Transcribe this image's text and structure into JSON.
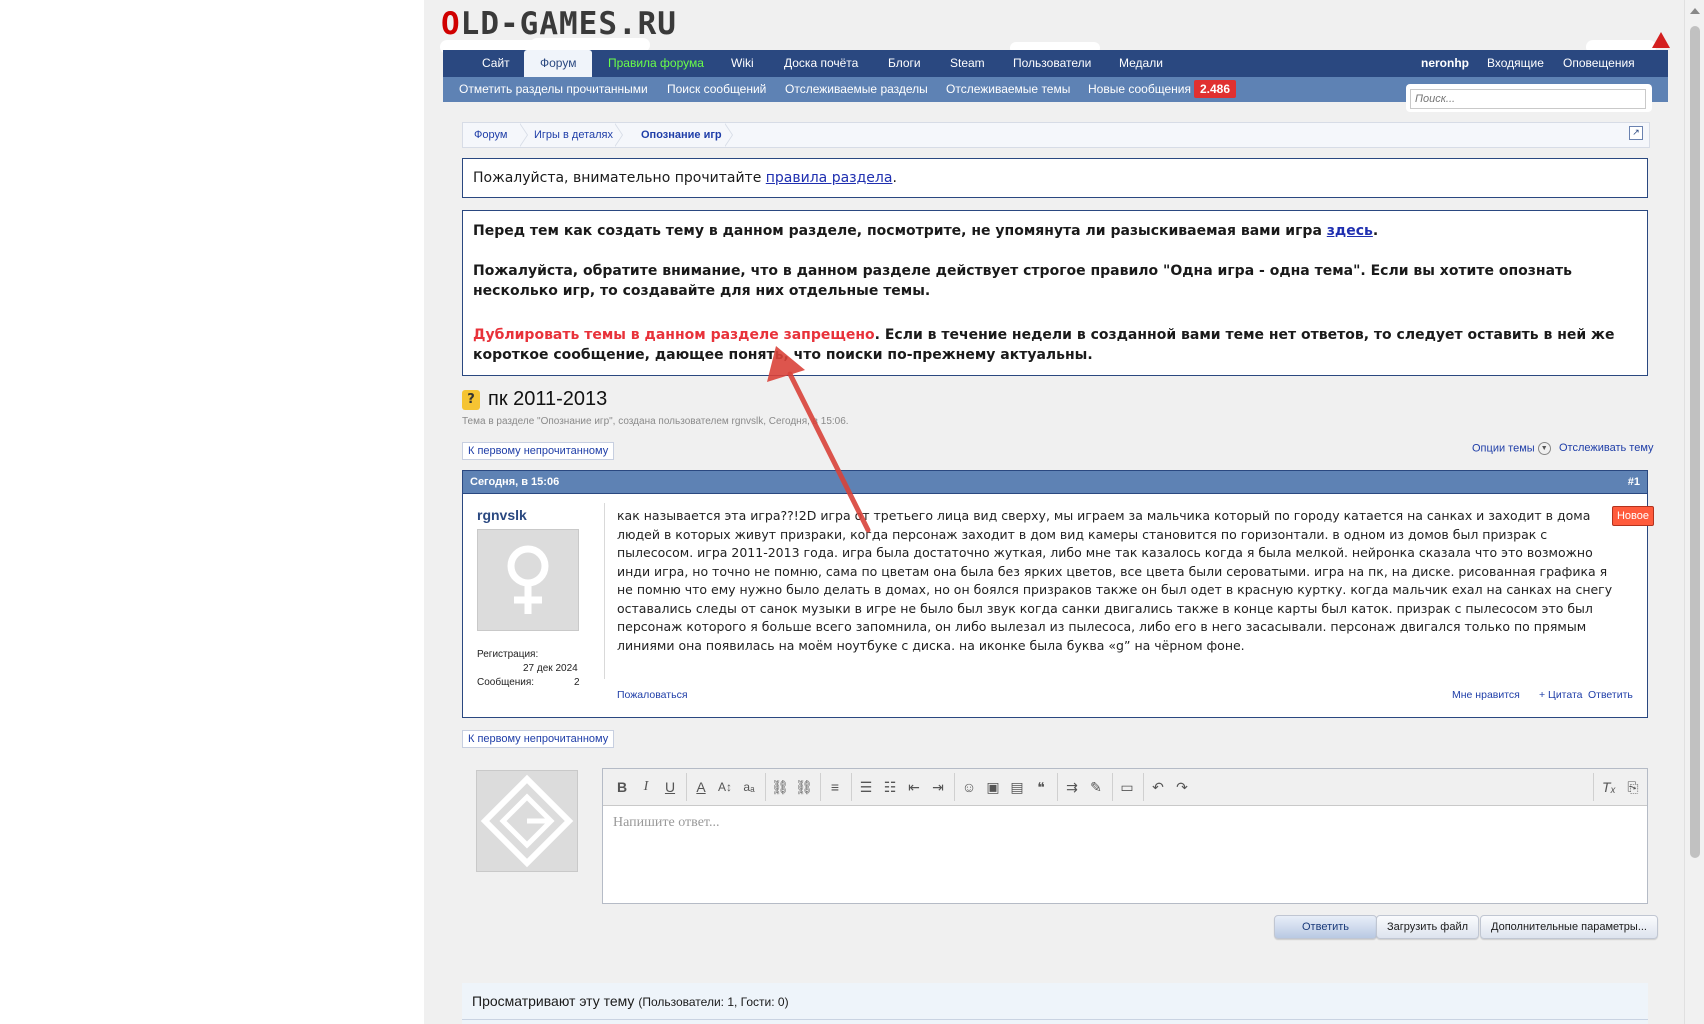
{
  "header": {
    "logo_first": "O",
    "logo_rest": "LD-GAMES.RU",
    "nav": [
      "Сайт",
      "Форум",
      "Правила форума",
      "Wiki",
      "Доска почёта",
      "Блоги",
      "Steam",
      "Пользователи",
      "Медали"
    ],
    "user": "neronhp",
    "inbox": "Входящие",
    "alerts": "Оповещения",
    "subnav": [
      "Отметить разделы прочитанными",
      "Поиск сообщений",
      "Отслеживаемые разделы",
      "Отслеживаемые темы",
      "Новые сообщения"
    ],
    "new_count": "2.486",
    "search_placeholder": "Поиск..."
  },
  "breadcrumb": [
    "Форум",
    "Игры в деталях",
    "Опознание игр"
  ],
  "notice1": {
    "before": "Пожалуйста, внимательно прочитайте ",
    "link": "правила раздела",
    "after": "."
  },
  "notice2": {
    "p1_before": "Перед тем как создать тему в данном разделе, посмотрите, не упомянута ли разыскиваемая вами игра ",
    "p1_link": "здесь",
    "p1_after": ".",
    "p2": "Пожалуйста, обратите внимание, что в данном разделе действует строгое правило \"Одна игра - одна тема\". Если вы хотите опознать несколько игр, то создавайте для них отдельные темы.",
    "p3_red": "Дублировать темы в данном разделе запрещено",
    "p3_rest": ". Если в течение недели в созданной вами теме нет ответов, то следует оставить в ней же короткое сообщение, дающее понять, что поиски по-прежнему актуальны."
  },
  "thread": {
    "prefix_icon": "?",
    "title": "пк 2011-2013",
    "meta": "Тема в разделе \"Опознание игр\", создана пользователем rgnvslk, Сегодня, в 15:06.",
    "first_unread": "К первому непрочитанному",
    "options": "Опции темы",
    "watch": "Отслеживать тему"
  },
  "post": {
    "date": "Сегодня, в 15:06",
    "number": "#1",
    "author": "rgnvslk",
    "reg_label": "Регистрация:",
    "reg_date": "27 дек 2024",
    "msgs_label": "Сообщения:",
    "msgs_count": "2",
    "new_tag": "Новое",
    "body": "как называется эта игра??!2D игра от третьего лица вид сверху, мы играем за мальчика который по городу катается на санках и заходит в дома людей в которых живут призраки, когда персонаж заходит в дом вид камеры становится по горизонтали. в одном из домов был призрак с пылесосом. игра 2011-2013 года. игра была достаточно жуткая, либо мне так казалось когда я была мелкой. нейронка сказала что это возможно инди игра, но точно не помню, сама по цветам она была без ярких цветов, все цвета были сероватыми. игра на пк, на диске. рисованная графика я не помню что ему нужно было делать в домах, но он боялся призраков также он был одет в красную куртку. когда мальчик ехал на санках на снегу оставались следы от санок музыки в игре не было был звук когда санки двигались также в конце карты был каток. призрак с пылесосом это был персонаж которого я больше всего запомнила, он либо вылезал из пылесоса, либо его в него засасывали. персонаж двигался только по прямым линиями она появилась на моём ноутбуке с диска. на иконке была буква «g” на чёрном фоне.",
    "report": "Пожаловаться",
    "like": "Мне нравится",
    "quote": "+ Цитата",
    "reply": "Ответить"
  },
  "reply": {
    "placeholder": "Напишите ответ...",
    "submit": "Ответить",
    "upload": "Загрузить файл",
    "more": "Дополнительные параметры..."
  },
  "viewers": {
    "title": "Просматривают эту тему",
    "counts": "(Пользователи: 1, Гости: 0)"
  },
  "colors": {
    "nav_dark": "#2a4880",
    "nav_light": "#5e82b4",
    "rule_red": "#e8323a",
    "arrow": "#d9433a"
  }
}
